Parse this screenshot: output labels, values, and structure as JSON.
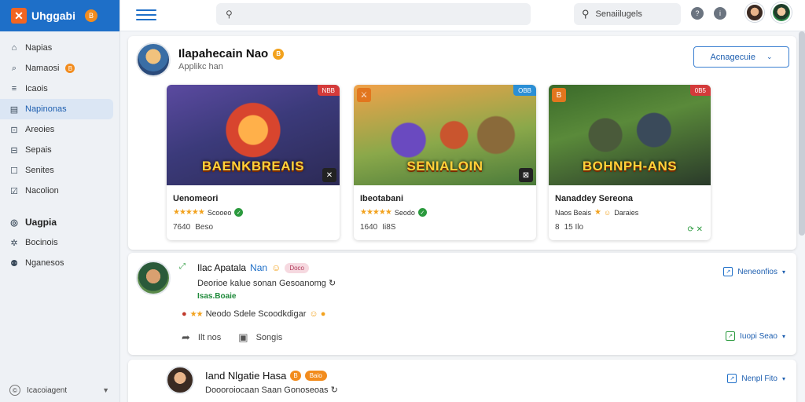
{
  "app": {
    "name": "Uhggabi",
    "logo_glyph": "✕",
    "badge": "B",
    "brand_color": "#1e6fc8"
  },
  "sidebar": {
    "items": [
      {
        "label": "Napias",
        "icon": "home-icon",
        "glyph": "⌂"
      },
      {
        "label": "Namaosi",
        "icon": "compass-icon",
        "glyph": "⌕",
        "badge": "B"
      },
      {
        "label": "Icaois",
        "icon": "list-icon",
        "glyph": "≡"
      },
      {
        "label": "Napinonas",
        "icon": "grid-icon",
        "glyph": "▤",
        "active": true
      },
      {
        "label": "Areoies",
        "icon": "square-icon",
        "glyph": "⊡"
      },
      {
        "label": "Sepais",
        "icon": "tag-icon",
        "glyph": "⊟"
      },
      {
        "label": "Senites",
        "icon": "box-icon",
        "glyph": "☐"
      },
      {
        "label": "Nacolion",
        "icon": "checkbox-icon",
        "glyph": "☑"
      }
    ],
    "section2_title": "Uagpia",
    "section2_items": [
      {
        "label": "Bocinois",
        "icon": "tools-icon",
        "glyph": "✲"
      },
      {
        "label": "Nganesos",
        "icon": "people-icon",
        "glyph": "⚉"
      }
    ],
    "footer": {
      "label": "Icacoiagent",
      "icon": "settings-icon",
      "glyph": "©"
    }
  },
  "topbar": {
    "search_main_placeholder": "",
    "search_side_text": "Senaiilugels",
    "icons": [
      "help-icon",
      "info-icon"
    ]
  },
  "profile": {
    "name": "Ilapahecain Nao",
    "badge": "B",
    "subtitle": "Applikc han",
    "dropdown_label": "Acnagecuie"
  },
  "cards": [
    {
      "art_text": "BAENKBREAIS",
      "tag": "NBB",
      "tag_color": "#d43a3a",
      "corner_glyph": "✕",
      "title": "Uenomeori",
      "stars": "★★★★★",
      "rating_text": "Scooeo",
      "meta1": "7640",
      "meta2": "Beso"
    },
    {
      "art_text": "SENIALOIN",
      "tag": "OBB",
      "tag_color": "#2b8fd6",
      "corner_glyph": "⊠",
      "title": "Ibeotabani",
      "stars": "★★★★★",
      "rating_text": "Seodo",
      "meta1": "1640",
      "meta2": "Ii8S"
    },
    {
      "art_text": "BOHNPH-ANS",
      "tag": "0B5",
      "tag_color": "#d43a3a",
      "corner_glyph": "B",
      "title": "Nanaddey Sereona",
      "stars": "★",
      "rating_text": "Naos  Beais",
      "rating_extra": "Daraies",
      "meta1": "8 ",
      "meta2": "15 Ilo"
    }
  ],
  "posts": [
    {
      "title": "Ilac Apatala",
      "highlight": "Nan",
      "pill": "Doco",
      "desc": "Deorioe kalue sonan Gesoanomg",
      "link": "Isas.Boaie",
      "reacts": "Neodo Sdele Scoodkdigar",
      "action1": "Ilt nos",
      "action2": "Songis",
      "right1": "Neneonfios",
      "right2": "Iuopi Seao"
    },
    {
      "title": "Iand Nlgatie Hasa",
      "pill1": "B",
      "pill2": "Baio",
      "desc": "Doooroiocaan Saan Gonoseoas",
      "right1": "Nenpl Fito"
    }
  ]
}
